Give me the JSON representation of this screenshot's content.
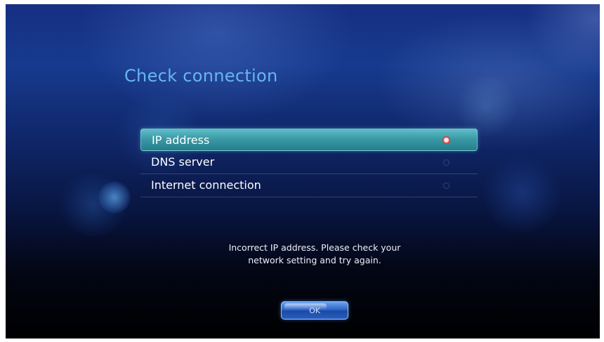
{
  "dialog": {
    "title": "Check connection"
  },
  "checks": [
    {
      "label": "IP address",
      "status": "error",
      "status_icon": "error-icon",
      "selected": true
    },
    {
      "label": "DNS server",
      "status": "pending",
      "status_icon": "radio-empty-icon",
      "selected": false
    },
    {
      "label": "Internet connection",
      "status": "pending",
      "status_icon": "radio-empty-icon",
      "selected": false
    }
  ],
  "message": {
    "line1": "Incorrect IP address. Please check your",
    "line2": "network setting and try again."
  },
  "ok_button": {
    "label": "OK"
  },
  "colors": {
    "title": "#66b7ee",
    "highlight": "#3a9aa6",
    "error": "#e33b3b",
    "button": "#2f66c9"
  }
}
